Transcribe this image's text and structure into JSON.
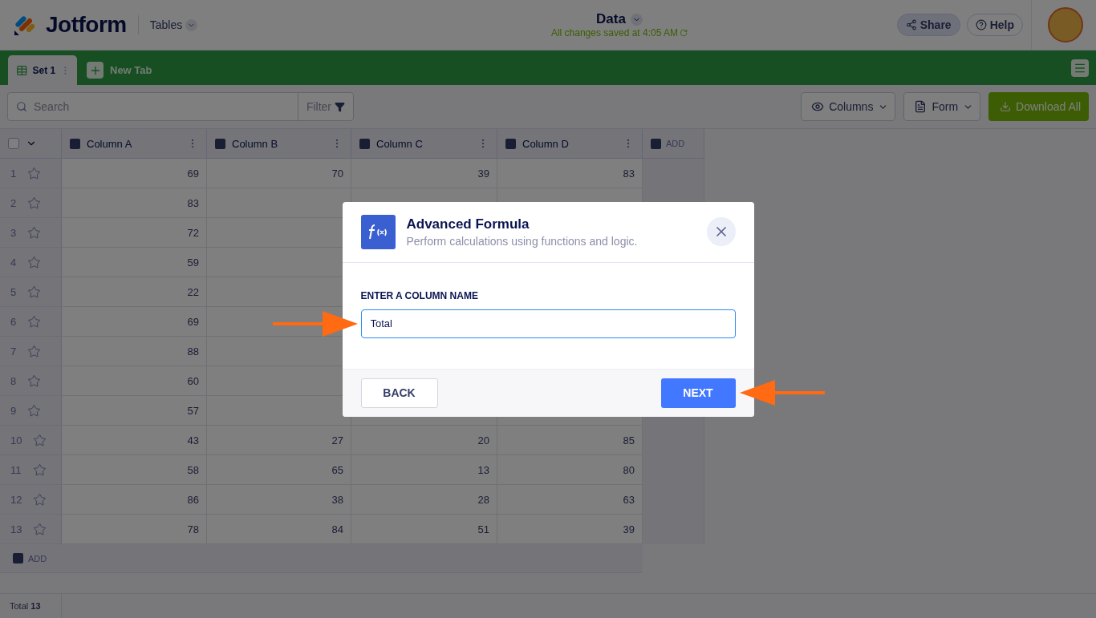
{
  "header": {
    "logo": "Jotform",
    "product": "Tables",
    "title": "Data",
    "save_status": "All changes saved at 4:05 AM",
    "share": "Share",
    "help": "Help"
  },
  "tabs": [
    {
      "label": "Set 1",
      "selected": true
    }
  ],
  "new_tab": "New Tab",
  "toolbar": {
    "search_placeholder": "Search",
    "filter": "Filter",
    "columns": "Columns",
    "form": "Form",
    "download": "Download All"
  },
  "table": {
    "select_all": {
      "checked": false
    },
    "columns": [
      "Column A",
      "Column B",
      "Column C",
      "Column D"
    ],
    "add_column": "ADD",
    "rows": [
      {
        "number": "1",
        "cells": [
          "69",
          "70",
          "39",
          "83"
        ]
      },
      {
        "number": "2",
        "cells": [
          "83",
          null,
          null,
          null
        ]
      },
      {
        "number": "3",
        "cells": [
          "72",
          null,
          null,
          null
        ]
      },
      {
        "number": "4",
        "cells": [
          "59",
          null,
          null,
          null
        ]
      },
      {
        "number": "5",
        "cells": [
          "22",
          null,
          null,
          null
        ]
      },
      {
        "number": "6",
        "cells": [
          "69",
          null,
          null,
          null
        ]
      },
      {
        "number": "7",
        "cells": [
          "88",
          null,
          null,
          null
        ]
      },
      {
        "number": "8",
        "cells": [
          "60",
          null,
          null,
          null
        ]
      },
      {
        "number": "9",
        "cells": [
          "57",
          null,
          null,
          null
        ]
      },
      {
        "number": "10",
        "cells": [
          "43",
          "27",
          "20",
          "85"
        ]
      },
      {
        "number": "11",
        "cells": [
          "58",
          "65",
          "13",
          "80"
        ]
      },
      {
        "number": "12",
        "cells": [
          "86",
          "38",
          "28",
          "63"
        ]
      },
      {
        "number": "13",
        "cells": [
          "78",
          "84",
          "51",
          "39"
        ]
      }
    ],
    "add_row": "ADD"
  },
  "footer": {
    "total": "Total **13**"
  },
  "modal": {
    "title": "Advanced Formula",
    "subtitle": "Perform calculations using functions and logic.",
    "field_label": "ENTER A COLUMN NAME",
    "value": "Total",
    "back": "BACK",
    "next": "NEXT"
  }
}
